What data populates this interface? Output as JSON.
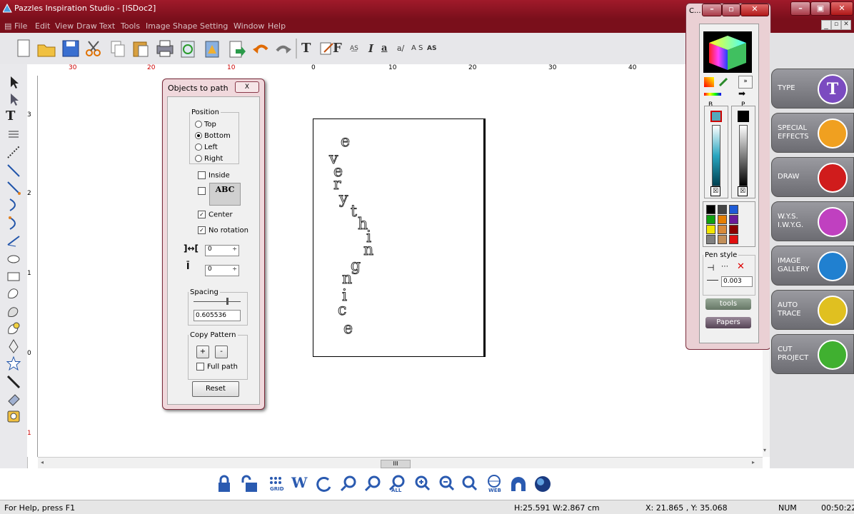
{
  "app": {
    "title": "Pazzles Inspiration Studio - [ISDoc2]",
    "menus": [
      "File",
      "Edit",
      "View",
      "Draw",
      "Text",
      "Tools",
      "Image",
      "Shape",
      "Setting",
      "Window",
      "Help"
    ],
    "title_color": "#8a1222"
  },
  "ruler": {
    "h_labels": [
      "30",
      "20",
      "10",
      "0",
      "10",
      "20",
      "30",
      "40"
    ],
    "v_labels": [
      "3",
      "2",
      "1",
      "0",
      "1"
    ]
  },
  "dialog": {
    "title": "Objects to path",
    "close": "X",
    "position_legend": "Position",
    "positions": [
      "Top",
      "Bottom",
      "Left",
      "Right"
    ],
    "selected_position": "Bottom",
    "inside_label": "Inside",
    "abc_label": "ABC",
    "center_label": "Center",
    "no_rotation_label": "No rotation",
    "h_gap_value": "0",
    "v_gap_value": "0",
    "spacing_legend": "Spacing",
    "spacing_value": "0.605536",
    "copy_pattern_legend": "Copy Pattern",
    "plus_label": "+",
    "minus_label": "-",
    "full_path_label": "Full path",
    "reset_label": "Reset"
  },
  "artwork": {
    "letters": [
      "e",
      "v",
      "e",
      "r",
      "y",
      "t",
      "h",
      "i",
      "n",
      "g",
      "n",
      "i",
      "c",
      "e"
    ]
  },
  "color_panel": {
    "title": "C...",
    "b_label": "B",
    "p_label": "P",
    "pen_style_label": "Pen style",
    "pen_value": "0.003",
    "tools_label": "tools",
    "papers_label": "Papers",
    "swatches": [
      "#000000",
      "#444444",
      "#1e5bd6",
      "#10a010",
      "#e67e00",
      "#6a1b9a",
      "#f2e600",
      "#d88a3a",
      "#8b0000",
      "#808080",
      "#c28f5a",
      "#e01010"
    ]
  },
  "right_panel": {
    "buttons": [
      {
        "label": "TYPE",
        "color": "#7b4bc0",
        "icon": "T"
      },
      {
        "label": "SPECIAL EFFECTS",
        "color": "#f0a020",
        "icon": "hammer"
      },
      {
        "label": "DRAW",
        "color": "#d01c1c",
        "icon": "pen"
      },
      {
        "label": "W.Y.S. I.W.Y.G.",
        "color": "#c040c0",
        "icon": "scissors"
      },
      {
        "label": "IMAGE GALLERY",
        "color": "#2080d0",
        "icon": "eye"
      },
      {
        "label": "AUTO TRACE",
        "color": "#e0c020",
        "icon": "trace"
      },
      {
        "label": "CUT PROJECT",
        "color": "#40b030",
        "icon": "pen"
      }
    ]
  },
  "bottom_icons": [
    "lock-icon",
    "unlock-icon",
    "grid-icon",
    "word-icon",
    "rotate-icon",
    "zoom-back-icon",
    "zoom-fit-icon",
    "zoom-all-icon",
    "zoom-in-icon",
    "zoom-out-icon",
    "zoom-page-icon",
    "web-icon",
    "arch-icon",
    "globe-icon"
  ],
  "grid_label": "GRID",
  "all_label": "ALL",
  "web_label": "WEB",
  "status": {
    "help": "For Help, press F1",
    "size": "H:25.591   W:2.867  cm",
    "coords": "X: 21.865 , Y: 35.068",
    "num": "NUM",
    "time": "00:50:22"
  }
}
